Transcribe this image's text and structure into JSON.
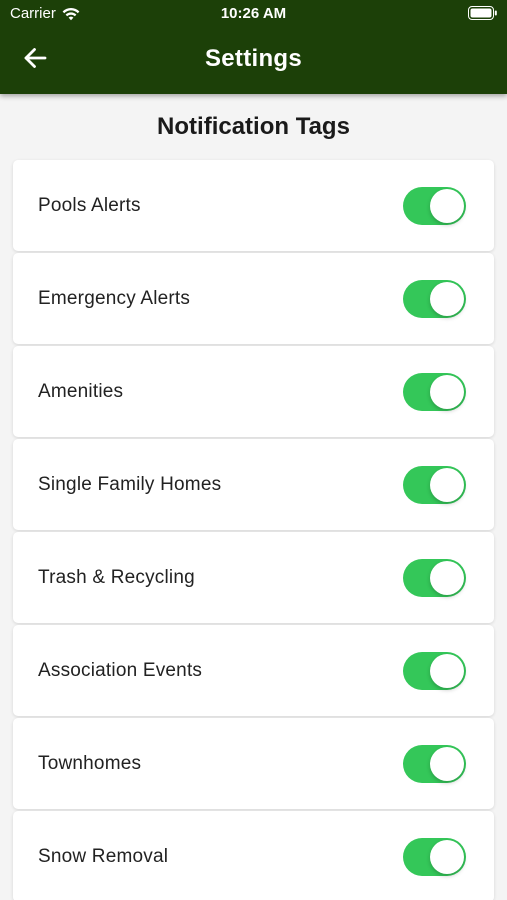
{
  "status_bar": {
    "carrier": "Carrier",
    "time": "10:26 AM",
    "wifi_icon": "wifi-icon",
    "battery_icon": "battery-full-icon"
  },
  "header": {
    "title": "Settings",
    "back_icon": "arrow-left-icon",
    "background_color": "#1c4008"
  },
  "section": {
    "title": "Notification Tags"
  },
  "toggle_color": "#34c759",
  "items": [
    {
      "label": "Pools Alerts",
      "enabled": true
    },
    {
      "label": "Emergency Alerts",
      "enabled": true
    },
    {
      "label": "Amenities",
      "enabled": true
    },
    {
      "label": "Single Family Homes",
      "enabled": true
    },
    {
      "label": "Trash & Recycling",
      "enabled": true
    },
    {
      "label": "Association Events",
      "enabled": true
    },
    {
      "label": "Townhomes",
      "enabled": true
    },
    {
      "label": "Snow Removal",
      "enabled": true
    }
  ]
}
